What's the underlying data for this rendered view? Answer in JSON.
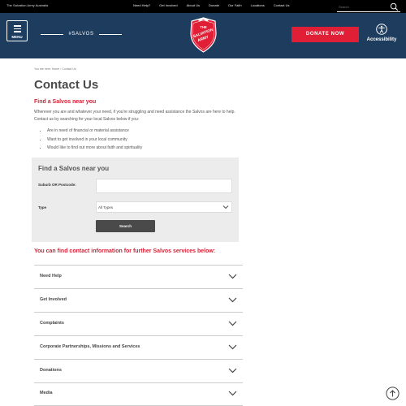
{
  "topbar": {
    "org_name": "The Salvation Army Australia",
    "links": [
      "Need Help?",
      "Get Involved",
      "About Us",
      "Donate",
      "Our Faith",
      "Locations",
      "Contact Us"
    ],
    "search_placeholder": "Search"
  },
  "header": {
    "menu_label": "MENU",
    "hashtag": "#SALVOS",
    "logo_text": "THE SALVATION ARMY",
    "donate_label": "DONATE NOW",
    "accessibility_label": "Accessibility",
    "colors": {
      "navy": "#1d3c5e",
      "red": "#e01f36"
    }
  },
  "breadcrumb": "You are here: Home › Contact Us",
  "page_title": "Contact Us",
  "intro": {
    "heading": "Find a Salvos near you",
    "text": "Wherever you are and whatever your need, if you're struggling and need assistance the Salvos are here to help. Contact us by searching for your local Salvos below if you:",
    "bullets": [
      "Are in need of financial or material assistance",
      "Want to get involved in your local community",
      "Would like to find out more about faith and spirituality"
    ]
  },
  "finder": {
    "title": "Find a Salvos near you",
    "suburb_label": "Suburb OR Postcode:",
    "suburb_value": "",
    "type_label": "Type",
    "type_selected": "All Types",
    "search_button": "Search"
  },
  "services": {
    "heading": "You can find contact information for further Salvos services below:",
    "items": [
      "Need Help",
      "Get Involved",
      "Complaints",
      "Corporate Partnerships, Missions and Services",
      "Donations",
      "Media"
    ]
  }
}
